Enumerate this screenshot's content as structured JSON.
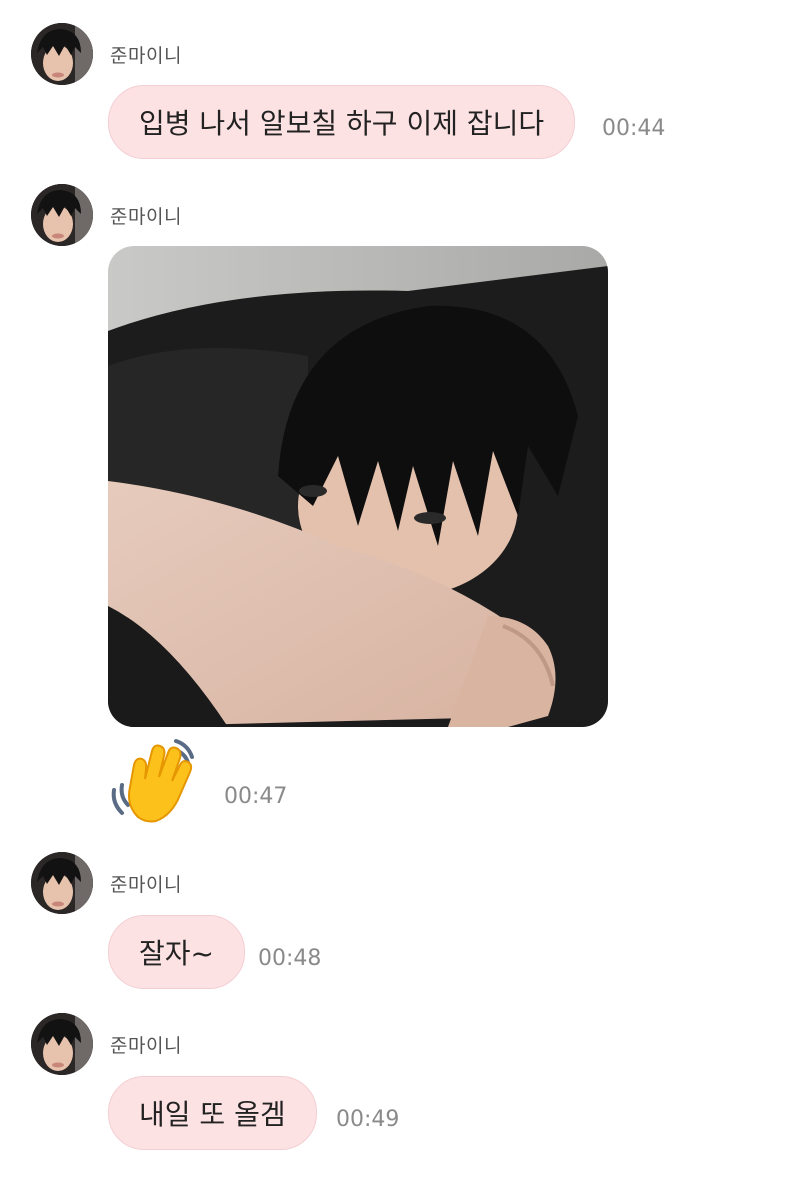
{
  "messages": [
    {
      "sender": "준마이니",
      "text": "입병 나서 알보칠 하구 이제 잡니다",
      "time": "00:44"
    },
    {
      "sender": "준마이니",
      "image": "selfie-photo",
      "emoji": "👋",
      "time": "00:47"
    },
    {
      "sender": "준마이니",
      "text": "잘자~",
      "time": "00:48"
    },
    {
      "sender": "준마이니",
      "text": "내일 또 올겜",
      "time": "00:49"
    }
  ],
  "colors": {
    "bubble_bg": "#fde2e4",
    "bubble_border": "#f3cfd3",
    "time_text": "#8a8a8a",
    "sender_text": "#555555"
  }
}
